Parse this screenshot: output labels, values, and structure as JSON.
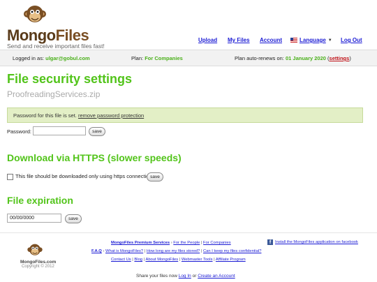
{
  "header": {
    "brand_a": "Mongo",
    "brand_b": "Files",
    "tagline": "Send and receive important files fast!",
    "nav": {
      "upload": "Upload",
      "my_files": "My Files",
      "account": "Account",
      "language": "Language",
      "logout": "Log Out"
    }
  },
  "status": {
    "logged_in_label": "Logged in as:",
    "user": "ulgar@gobul.com",
    "plan_label": "Plan:",
    "plan": "For Companies",
    "renew_label": "Plan auto-renews on:",
    "renew_date": "01 January 2020",
    "settings": "settings"
  },
  "page": {
    "title": "File security settings",
    "filename": "ProofreadingServices.zip",
    "pw_notice": "Password for this file is set.",
    "pw_remove": "remove password protection",
    "pw_label": "Password:",
    "save": "save",
    "https_title": "Download via HTTPS (slower speeds)",
    "https_label": "This file should be downloaded only using https connection",
    "exp_title": "File expiration",
    "exp_value": "00/00/0000"
  },
  "footer": {
    "brand": "MongoFiles.com",
    "copyright": "Copyright © 2012",
    "premium": "MongoFiles Premium Services",
    "sep": "›",
    "for_people": "For the People",
    "for_companies": "For Companies",
    "faq": "F.A.Q",
    "q1": "What is MongoFiles?",
    "q2": "How long are my files stored?",
    "q3": "Can I keep my files confidential?",
    "contact": "Contact Us",
    "blog": "Blog",
    "about": "About MongoFiles",
    "webmaster": "Webmaster Tools",
    "affiliate": "Affiliate Program",
    "facebook": "Install the MongoFiles application on facebook",
    "share_a": "Share your files now",
    "login": "Log In",
    "or": "or",
    "create": "Create an Account"
  },
  "colors": {
    "accent_green": "#52c41a",
    "link_blue": "#1a1ad4",
    "notice_bg": "#e3efc6"
  }
}
